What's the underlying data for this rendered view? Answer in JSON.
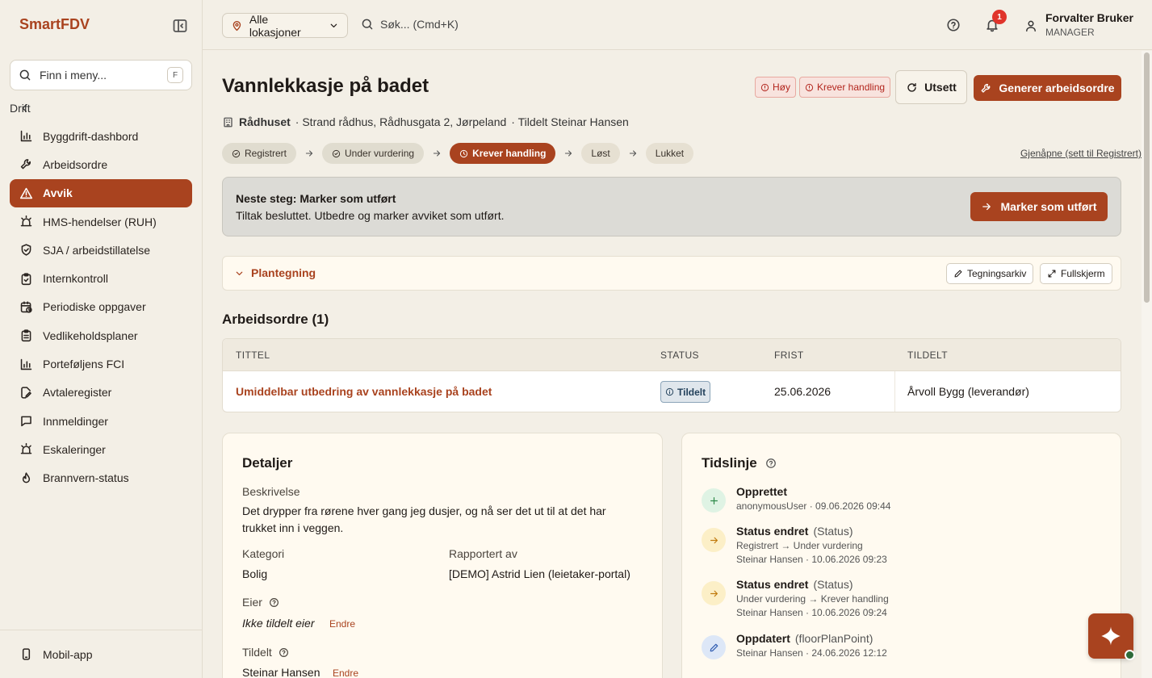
{
  "app": {
    "brand": "SmartFDV"
  },
  "sidebar": {
    "search_placeholder": "Finn i meny...",
    "search_shortcut": "F",
    "section": "Drift",
    "items": [
      {
        "label": "Byggdrift-dashbord",
        "icon": "bar-chart-icon"
      },
      {
        "label": "Arbeidsordre",
        "icon": "wrench-icon"
      },
      {
        "label": "Avvik",
        "icon": "warning-icon",
        "active": true
      },
      {
        "label": "HMS-hendelser (RUH)",
        "icon": "siren-icon"
      },
      {
        "label": "SJA / arbeidstillatelse",
        "icon": "shield-check-icon"
      },
      {
        "label": "Internkontroll",
        "icon": "clipboard-check-icon"
      },
      {
        "label": "Periodiske oppgaver",
        "icon": "calendar-clock-icon"
      },
      {
        "label": "Vedlikeholdsplaner",
        "icon": "clipboard-list-icon"
      },
      {
        "label": "Porteføljens FCI",
        "icon": "bar-chart-icon"
      },
      {
        "label": "Avtaleregister",
        "icon": "file-pen-icon"
      },
      {
        "label": "Innmeldinger",
        "icon": "message-icon"
      },
      {
        "label": "Eskaleringer",
        "icon": "siren-icon"
      },
      {
        "label": "Brannvern-status",
        "icon": "flame-icon"
      }
    ],
    "footer_label": "Mobil-app"
  },
  "topbar": {
    "location_select": "Alle lokasjoner",
    "search_placeholder": "Søk... (Cmd+K)",
    "notification_count": "1",
    "user_name": "Forvalter Bruker",
    "user_role": "MANAGER"
  },
  "deviation": {
    "title": "Vannlekkasje på badet",
    "priority": "Høy",
    "action_status": "Krever handling",
    "postpone_label": "Utsett",
    "generate_label": "Generer arbeidsordre",
    "building": "Rådhuset",
    "address": "· Strand rådhus, Rådhusgata 2, Jørpeland",
    "assigned_line": "·  Tildelt Steinar Hansen",
    "steps": [
      "Registrert",
      "Under vurdering",
      "Krever handling",
      "Løst",
      "Lukket"
    ],
    "reopen_label": "Gjenåpne (sett til Registrert)"
  },
  "next_step": {
    "title": "Neste steg: Marker som utført",
    "description": "Tiltak besluttet. Utbedre og marker avviket som utført.",
    "button": "Marker som utført"
  },
  "floor_plan": {
    "title": "Plantegning",
    "archive_label": "Tegningsarkiv",
    "fullscreen_label": "Fullskjerm"
  },
  "work_orders": {
    "heading": "Arbeidsordre (1)",
    "columns": [
      "TITTEL",
      "STATUS",
      "FRIST",
      "TILDELT"
    ],
    "rows": [
      {
        "title": "Umiddelbar utbedring av vannlekkasje på badet",
        "status": "Tildelt",
        "due": "25.06.2026",
        "assigned": "Årvoll Bygg (leverandør)"
      }
    ]
  },
  "details": {
    "title": "Detaljer",
    "description_label": "Beskrivelse",
    "description": "Det drypper fra rørene hver gang jeg dusjer, og nå ser det ut til at det har trukket inn i veggen.",
    "category_label": "Kategori",
    "category": "Bolig",
    "reported_by_label": "Rapportert av",
    "reported_by": "[DEMO] Astrid Lien (leietaker-portal)",
    "owner_label": "Eier",
    "owner": "Ikke tildelt eier",
    "owner_edit": "Endre",
    "assigned_label": "Tildelt",
    "assigned": "Steinar Hansen",
    "assigned_edit": "Endre"
  },
  "timeline": {
    "title": "Tidslinje",
    "events": [
      {
        "title": "Opprettet",
        "sub": "",
        "lines": [
          "anonymousUser · 09.06.2026 09:44"
        ],
        "icon": "plus-icon",
        "color": "#dff3e4"
      },
      {
        "title": "Status endret",
        "sub": "(Status)",
        "lines": [
          "Registrert → Under vurdering",
          "Steinar Hansen · 10.06.2026 09:23"
        ],
        "icon": "arrow-right-icon",
        "color": "#fcefc7"
      },
      {
        "title": "Status endret",
        "sub": "(Status)",
        "lines": [
          "Under vurdering → Krever handling",
          "Steinar Hansen · 10.06.2026 09:24"
        ],
        "icon": "arrow-right-icon",
        "color": "#fcefc7"
      },
      {
        "title": "Oppdatert",
        "sub": "(floorPlanPoint)",
        "lines": [
          "Steinar Hansen · 24.06.2026 12:12"
        ],
        "icon": "pencil-icon",
        "color": "#dde7f7"
      }
    ]
  },
  "colors": {
    "accent": "#a9431f",
    "background": "#f3efe6"
  }
}
